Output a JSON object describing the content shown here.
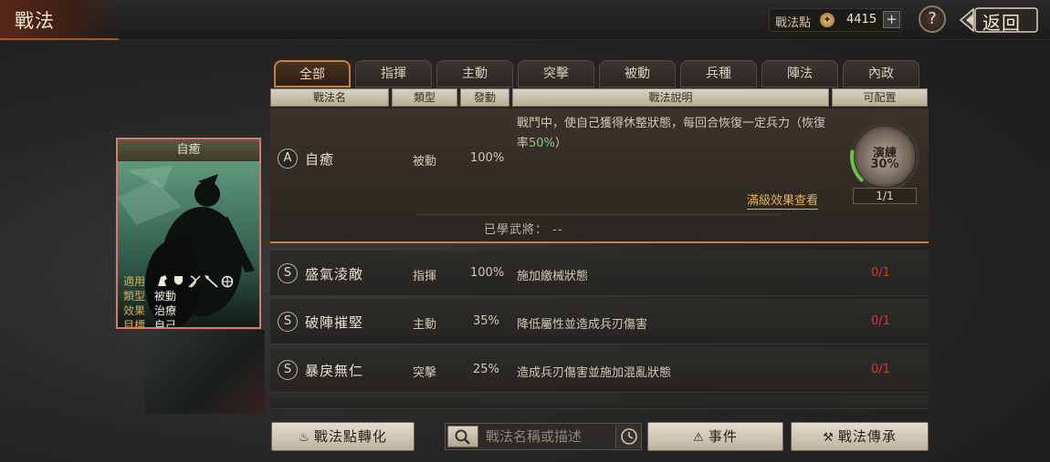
{
  "header": {
    "title": "戰法",
    "points_label": "戰法點",
    "points_value": "4415",
    "plus_label": "+",
    "help_label": "?",
    "back_label": "返回"
  },
  "tabs": [
    {
      "label": "全部",
      "active": true
    },
    {
      "label": "指揮"
    },
    {
      "label": "主動"
    },
    {
      "label": "突擊"
    },
    {
      "label": "被動"
    },
    {
      "label": "兵種"
    },
    {
      "label": "陣法"
    },
    {
      "label": "內政"
    }
  ],
  "columns": {
    "name": "戰法名",
    "type": "類型",
    "rate": "發動",
    "desc": "戰法說明",
    "assign": "可配置"
  },
  "expanded_skill": {
    "grade": "A",
    "name": "自癒",
    "type": "被動",
    "rate": "100%",
    "desc_prefix": "戰鬥中，使自己獲得休整狀態，每回合恢復一定兵力（恢復率",
    "desc_highlight": "50%",
    "desc_suffix": "）",
    "full_effect_link": "滿級效果查看",
    "learned_label": "已學武將：",
    "learned_value": "--",
    "training_label": "演練",
    "training_pct": "30%",
    "training_count": "1/1"
  },
  "skills": [
    {
      "grade": "S",
      "name": "盛氣淩敵",
      "type": "指揮",
      "rate": "100%",
      "desc": "施加繳械狀態",
      "count": "0/1"
    },
    {
      "grade": "S",
      "name": "破陣摧堅",
      "type": "主動",
      "rate": "35%",
      "desc": "降低屬性並造成兵刃傷害",
      "count": "0/1"
    },
    {
      "grade": "S",
      "name": "暴戾無仁",
      "type": "突擊",
      "rate": "25%",
      "desc": "造成兵刃傷害並施加混亂狀態",
      "count": "0/1"
    }
  ],
  "card": {
    "title": "自癒",
    "apply_key": "適用",
    "type_key": "類型",
    "type_value": "被動",
    "effect_key": "效果",
    "effect_value": "治療",
    "target_key": "目標",
    "target_value": "自己",
    "apply_icons": [
      "cavalry-icon",
      "shield-icon",
      "bow-icon",
      "spear-icon",
      "wheel-icon"
    ]
  },
  "bottom": {
    "convert_label": "戰法點轉化",
    "search_placeholder": "戰法名稱或描述",
    "events_label": "事件",
    "inherit_label": "戰法傳承"
  },
  "colors": {
    "accent": "#c9803a",
    "highlight_green": "#7fd07a",
    "count_red": "#d23a2a",
    "card_border": "#d9796e"
  }
}
